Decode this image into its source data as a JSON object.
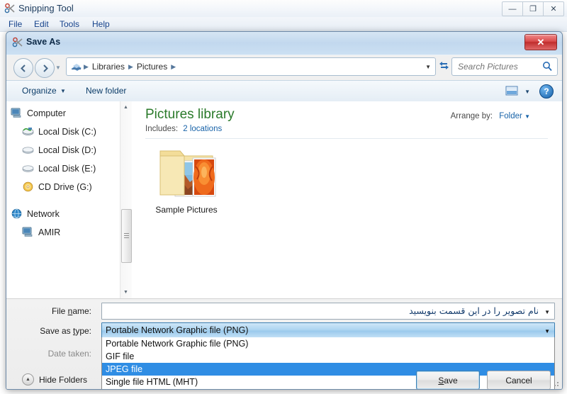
{
  "app": {
    "title": "Snipping Tool",
    "menus": [
      "File",
      "Edit",
      "Tools",
      "Help"
    ],
    "window_buttons": [
      {
        "name": "minimize",
        "glyph": "—"
      },
      {
        "name": "maximize",
        "glyph": "❐"
      },
      {
        "name": "close",
        "glyph": "✕"
      }
    ]
  },
  "dialog": {
    "title": "Save As",
    "close_label": "✕",
    "nav": {
      "back_label": "←",
      "forward_label": "→",
      "history_label": "▼",
      "breadcrumbs": [
        "Libraries",
        "Pictures"
      ],
      "breadcrumb_separator": "▶",
      "address_dropdown": "▼",
      "refresh_label": "↻"
    },
    "search": {
      "placeholder": "Search Pictures",
      "value": "",
      "icon": "search-icon"
    },
    "commandbar": {
      "organize_label": "Organize",
      "organize_caret": "▼",
      "new_folder_label": "New folder",
      "view_caret": "▼",
      "help_label": "?"
    },
    "navpane": {
      "items": [
        {
          "label": "Computer",
          "icon": "computer-icon",
          "indent": false
        },
        {
          "label": "Local Disk (C:)",
          "icon": "system-disk-icon",
          "indent": true
        },
        {
          "label": "Local Disk (D:)",
          "icon": "disk-icon",
          "indent": true
        },
        {
          "label": "Local Disk (E:)",
          "icon": "disk-icon",
          "indent": true
        },
        {
          "label": "CD Drive (G:)",
          "icon": "cd-drive-icon",
          "indent": true
        },
        {
          "label": "Network",
          "icon": "network-icon",
          "indent": false
        },
        {
          "label": "AMIR",
          "icon": "computer-icon",
          "indent": true
        }
      ],
      "scroll_up": "▲",
      "scroll_down": "▼"
    },
    "library": {
      "title": "Pictures library",
      "includes_label": "Includes:",
      "includes_value": "2 locations",
      "arrange_label": "Arrange by:",
      "arrange_value": "Folder",
      "arrange_caret": "▼"
    },
    "files": [
      {
        "name": "Sample Pictures",
        "icon": "folder-with-pictures-icon"
      }
    ],
    "form": {
      "filename_label": "File name:",
      "filename_value": "نام تصویر را در این قسمت بنویسید",
      "filename_caret": "▼",
      "savetype_label": "Save as type:",
      "savetype_value": "Portable Network Graphic file (PNG)",
      "savetype_caret": "▼",
      "datetaken_label": "Date taken:",
      "savetype_options": [
        {
          "label": "Portable Network Graphic file (PNG)",
          "selected": false
        },
        {
          "label": "GIF file",
          "selected": false
        },
        {
          "label": "JPEG file",
          "selected": true
        },
        {
          "label": "Single file HTML (MHT)",
          "selected": false
        }
      ]
    },
    "footer": {
      "hide_folders_label": "Hide Folders",
      "hide_folders_caret": "▲",
      "save_label": "Save",
      "cancel_label": "Cancel"
    }
  },
  "colors": {
    "accent_blue": "#2f8de4",
    "library_green": "#2a7a2a",
    "link_blue": "#1762a8",
    "close_red": "#c02d2d",
    "selected_combo": "#aad3f0"
  }
}
